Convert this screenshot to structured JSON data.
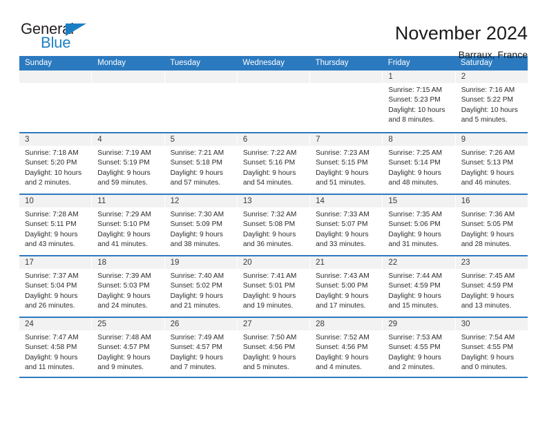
{
  "brand": {
    "name_part1": "General",
    "name_part2": "Blue"
  },
  "header": {
    "title": "November 2024",
    "location": "Barraux, France"
  },
  "colors": {
    "header_blue": "#2b79bf",
    "brand_blue": "#1c7fc4",
    "daynum_bg": "#f2f2f2",
    "text": "#2b2b2b"
  },
  "weekdays": [
    "Sunday",
    "Monday",
    "Tuesday",
    "Wednesday",
    "Thursday",
    "Friday",
    "Saturday"
  ],
  "weeks": [
    [
      {
        "day": "",
        "empty": true
      },
      {
        "day": "",
        "empty": true
      },
      {
        "day": "",
        "empty": true
      },
      {
        "day": "",
        "empty": true
      },
      {
        "day": "",
        "empty": true
      },
      {
        "day": "1",
        "sunrise": "Sunrise: 7:15 AM",
        "sunset": "Sunset: 5:23 PM",
        "daylight": "Daylight: 10 hours and 8 minutes."
      },
      {
        "day": "2",
        "sunrise": "Sunrise: 7:16 AM",
        "sunset": "Sunset: 5:22 PM",
        "daylight": "Daylight: 10 hours and 5 minutes."
      }
    ],
    [
      {
        "day": "3",
        "sunrise": "Sunrise: 7:18 AM",
        "sunset": "Sunset: 5:20 PM",
        "daylight": "Daylight: 10 hours and 2 minutes."
      },
      {
        "day": "4",
        "sunrise": "Sunrise: 7:19 AM",
        "sunset": "Sunset: 5:19 PM",
        "daylight": "Daylight: 9 hours and 59 minutes."
      },
      {
        "day": "5",
        "sunrise": "Sunrise: 7:21 AM",
        "sunset": "Sunset: 5:18 PM",
        "daylight": "Daylight: 9 hours and 57 minutes."
      },
      {
        "day": "6",
        "sunrise": "Sunrise: 7:22 AM",
        "sunset": "Sunset: 5:16 PM",
        "daylight": "Daylight: 9 hours and 54 minutes."
      },
      {
        "day": "7",
        "sunrise": "Sunrise: 7:23 AM",
        "sunset": "Sunset: 5:15 PM",
        "daylight": "Daylight: 9 hours and 51 minutes."
      },
      {
        "day": "8",
        "sunrise": "Sunrise: 7:25 AM",
        "sunset": "Sunset: 5:14 PM",
        "daylight": "Daylight: 9 hours and 48 minutes."
      },
      {
        "day": "9",
        "sunrise": "Sunrise: 7:26 AM",
        "sunset": "Sunset: 5:13 PM",
        "daylight": "Daylight: 9 hours and 46 minutes."
      }
    ],
    [
      {
        "day": "10",
        "sunrise": "Sunrise: 7:28 AM",
        "sunset": "Sunset: 5:11 PM",
        "daylight": "Daylight: 9 hours and 43 minutes."
      },
      {
        "day": "11",
        "sunrise": "Sunrise: 7:29 AM",
        "sunset": "Sunset: 5:10 PM",
        "daylight": "Daylight: 9 hours and 41 minutes."
      },
      {
        "day": "12",
        "sunrise": "Sunrise: 7:30 AM",
        "sunset": "Sunset: 5:09 PM",
        "daylight": "Daylight: 9 hours and 38 minutes."
      },
      {
        "day": "13",
        "sunrise": "Sunrise: 7:32 AM",
        "sunset": "Sunset: 5:08 PM",
        "daylight": "Daylight: 9 hours and 36 minutes."
      },
      {
        "day": "14",
        "sunrise": "Sunrise: 7:33 AM",
        "sunset": "Sunset: 5:07 PM",
        "daylight": "Daylight: 9 hours and 33 minutes."
      },
      {
        "day": "15",
        "sunrise": "Sunrise: 7:35 AM",
        "sunset": "Sunset: 5:06 PM",
        "daylight": "Daylight: 9 hours and 31 minutes."
      },
      {
        "day": "16",
        "sunrise": "Sunrise: 7:36 AM",
        "sunset": "Sunset: 5:05 PM",
        "daylight": "Daylight: 9 hours and 28 minutes."
      }
    ],
    [
      {
        "day": "17",
        "sunrise": "Sunrise: 7:37 AM",
        "sunset": "Sunset: 5:04 PM",
        "daylight": "Daylight: 9 hours and 26 minutes."
      },
      {
        "day": "18",
        "sunrise": "Sunrise: 7:39 AM",
        "sunset": "Sunset: 5:03 PM",
        "daylight": "Daylight: 9 hours and 24 minutes."
      },
      {
        "day": "19",
        "sunrise": "Sunrise: 7:40 AM",
        "sunset": "Sunset: 5:02 PM",
        "daylight": "Daylight: 9 hours and 21 minutes."
      },
      {
        "day": "20",
        "sunrise": "Sunrise: 7:41 AM",
        "sunset": "Sunset: 5:01 PM",
        "daylight": "Daylight: 9 hours and 19 minutes."
      },
      {
        "day": "21",
        "sunrise": "Sunrise: 7:43 AM",
        "sunset": "Sunset: 5:00 PM",
        "daylight": "Daylight: 9 hours and 17 minutes."
      },
      {
        "day": "22",
        "sunrise": "Sunrise: 7:44 AM",
        "sunset": "Sunset: 4:59 PM",
        "daylight": "Daylight: 9 hours and 15 minutes."
      },
      {
        "day": "23",
        "sunrise": "Sunrise: 7:45 AM",
        "sunset": "Sunset: 4:59 PM",
        "daylight": "Daylight: 9 hours and 13 minutes."
      }
    ],
    [
      {
        "day": "24",
        "sunrise": "Sunrise: 7:47 AM",
        "sunset": "Sunset: 4:58 PM",
        "daylight": "Daylight: 9 hours and 11 minutes."
      },
      {
        "day": "25",
        "sunrise": "Sunrise: 7:48 AM",
        "sunset": "Sunset: 4:57 PM",
        "daylight": "Daylight: 9 hours and 9 minutes."
      },
      {
        "day": "26",
        "sunrise": "Sunrise: 7:49 AM",
        "sunset": "Sunset: 4:57 PM",
        "daylight": "Daylight: 9 hours and 7 minutes."
      },
      {
        "day": "27",
        "sunrise": "Sunrise: 7:50 AM",
        "sunset": "Sunset: 4:56 PM",
        "daylight": "Daylight: 9 hours and 5 minutes."
      },
      {
        "day": "28",
        "sunrise": "Sunrise: 7:52 AM",
        "sunset": "Sunset: 4:56 PM",
        "daylight": "Daylight: 9 hours and 4 minutes."
      },
      {
        "day": "29",
        "sunrise": "Sunrise: 7:53 AM",
        "sunset": "Sunset: 4:55 PM",
        "daylight": "Daylight: 9 hours and 2 minutes."
      },
      {
        "day": "30",
        "sunrise": "Sunrise: 7:54 AM",
        "sunset": "Sunset: 4:55 PM",
        "daylight": "Daylight: 9 hours and 0 minutes."
      }
    ]
  ]
}
